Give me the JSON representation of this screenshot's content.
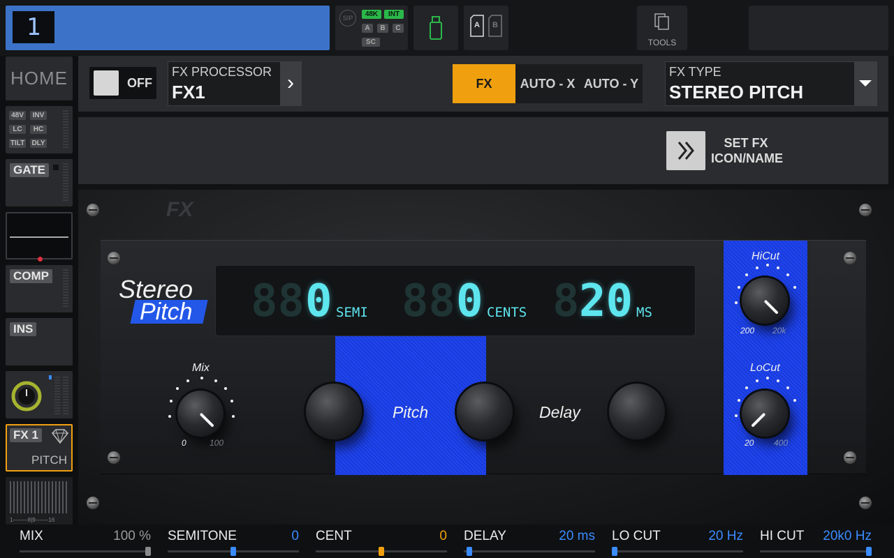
{
  "top": {
    "channel_number": "1",
    "sip_label": "SIP",
    "tag_48k": "48K",
    "tag_int": "INT",
    "tag_a": "A",
    "tag_b": "B",
    "tag_c": "C",
    "tag_sc": "SC",
    "card_a": "A",
    "card_b": "B",
    "tools_label": "TOOLS"
  },
  "sidebar": {
    "home_label": "HOME",
    "input_tags": [
      "48V",
      "INV",
      "LC",
      "HC",
      "TILT",
      "DLY"
    ],
    "gate_label": "GATE",
    "comp_label": "COMP",
    "ins_label": "INS",
    "fx_label": "FX 1",
    "fx_sub": "PITCH",
    "meter_scale": "1--------8|9-------16"
  },
  "header": {
    "onoff_label": "OFF",
    "processor_label": "FX PROCESSOR",
    "processor_value": "FX1",
    "tab_fx": "FX",
    "tab_auto_x": "AUTO - X",
    "tab_auto_y": "AUTO - Y",
    "type_label": "FX TYPE",
    "type_value": "STEREO PITCH",
    "set_fx_label_1": "SET FX",
    "set_fx_label_2": "ICON/NAME"
  },
  "rack": {
    "logo": "FX",
    "brand_line1": "Stereo",
    "brand_line2": "Pitch",
    "display": {
      "ghost1": "88",
      "semi_value": "0",
      "semi_unit": "SEMI",
      "ghost2": "88",
      "cents_value": "0",
      "cents_unit": "CENTS",
      "ghost3": "8",
      "ms_value": "20",
      "ms_unit": "MS"
    },
    "mix_label": "Mix",
    "mix_min": "0",
    "mix_max": "100",
    "mix_level": 1.0,
    "pitch_label": "Pitch",
    "delay_label": "Delay",
    "hicut_label": "HiCut",
    "hicut_min": "200",
    "hicut_max": "20k",
    "hicut_level": 1.0,
    "locut_label": "LoCut",
    "locut_min": "20",
    "locut_max": "400",
    "locut_level": 0.0
  },
  "params": [
    {
      "name": "MIX",
      "value": "100 %",
      "color": "#9a9a9a",
      "pos": 1.0
    },
    {
      "name": "SEMITONE",
      "value": "0",
      "color": "#3a8cff",
      "pos": 0.5
    },
    {
      "name": "CENT",
      "value": "0",
      "color": "#f0a00f",
      "pos": 0.5
    },
    {
      "name": "DELAY",
      "value": "20 ms",
      "color": "#3a8cff",
      "pos": 0.02
    },
    {
      "name": "LO CUT",
      "value": "20 Hz",
      "color": "#3a8cff",
      "pos": 0.0
    },
    {
      "name": "HI CUT",
      "value": "20k0 Hz",
      "color": "#3a8cff",
      "pos": 1.0
    }
  ],
  "colors": {
    "accent_blue": "#3c73c8",
    "fx_tab_orange": "#f0a00f",
    "display_cyan": "#5ee6ef",
    "rack_blue": "#1c3fe6"
  }
}
